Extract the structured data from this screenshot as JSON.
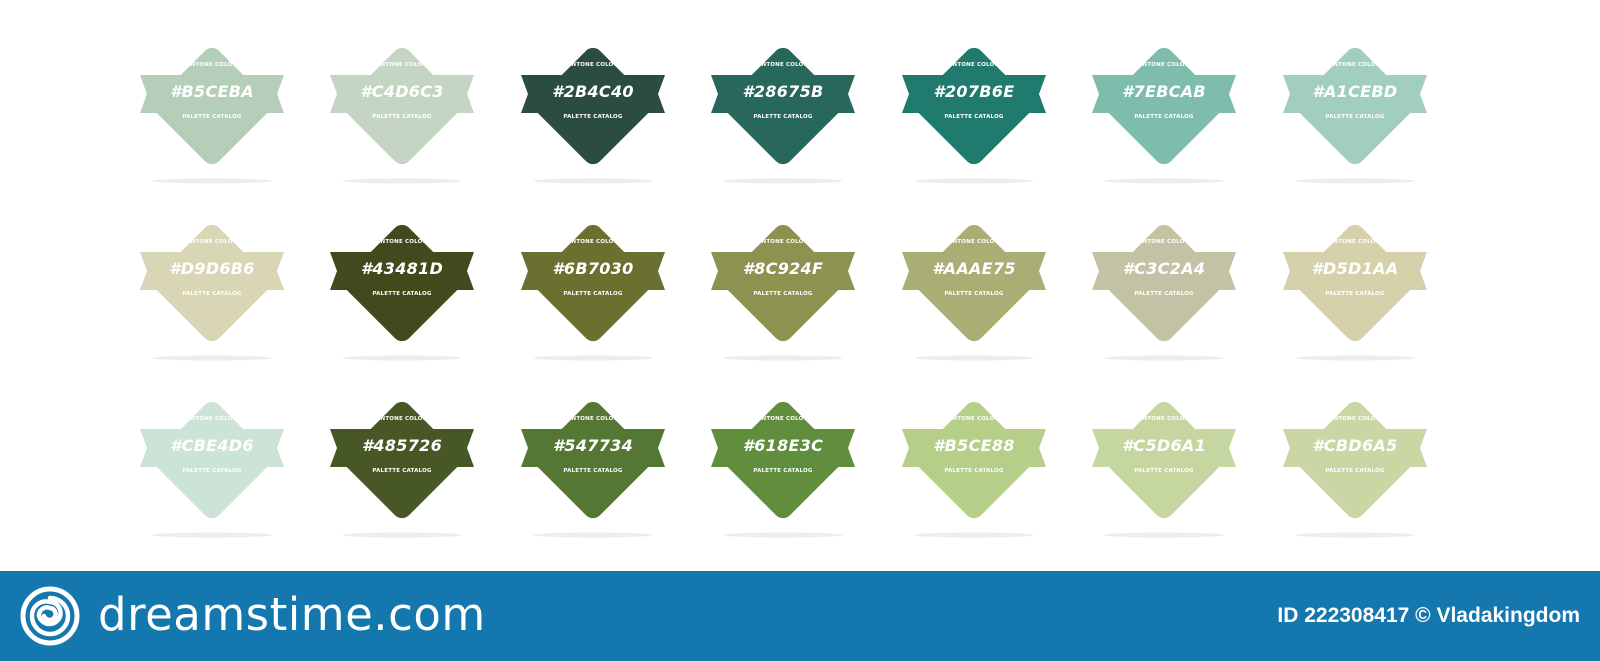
{
  "swatch_top_label": "PANTONE COLOUR",
  "swatch_bottom_label": "PALETTE CATALOG",
  "rows": [
    [
      {
        "hex": "#B5CEBA",
        "color": "#B5CEBA"
      },
      {
        "hex": "#C4D6C3",
        "color": "#C4D6C3"
      },
      {
        "hex": "#2B4C40",
        "color": "#2B4C40"
      },
      {
        "hex": "#28675B",
        "color": "#28675B"
      },
      {
        "hex": "#207B6E",
        "color": "#207B6E"
      },
      {
        "hex": "#7EBCAB",
        "color": "#7EBCAB"
      },
      {
        "hex": "#A1CEBD",
        "color": "#A1CEBD"
      }
    ],
    [
      {
        "hex": "#D9D6B6",
        "color": "#D9D6B6"
      },
      {
        "hex": "#43481D",
        "color": "#43481D"
      },
      {
        "hex": "#6B7030",
        "color": "#6B7030"
      },
      {
        "hex": "#8C924F",
        "color": "#8C924F"
      },
      {
        "hex": "#AAAE75",
        "color": "#AAAE75"
      },
      {
        "hex": "#C3C2A4",
        "color": "#C3C2A4"
      },
      {
        "hex": "#D5D1AA",
        "color": "#D5D1AA"
      }
    ],
    [
      {
        "hex": "#CBE4D6",
        "color": "#CBE4D6"
      },
      {
        "hex": "#485726",
        "color": "#485726"
      },
      {
        "hex": "#547734",
        "color": "#547734"
      },
      {
        "hex": "#618E3C",
        "color": "#618E3C"
      },
      {
        "hex": "#B5CE88",
        "color": "#B5CE88"
      },
      {
        "hex": "#C5D6A1",
        "color": "#C5D6A1"
      },
      {
        "hex": "#CBD6A5",
        "color": "#CBD6A5"
      }
    ]
  ],
  "footer": {
    "brand": "dreamstime.com",
    "credit": "ID 222308417 © Vladakingdom",
    "background": "#1477AD",
    "logo_icon": "dreamstime-spiral-icon"
  }
}
